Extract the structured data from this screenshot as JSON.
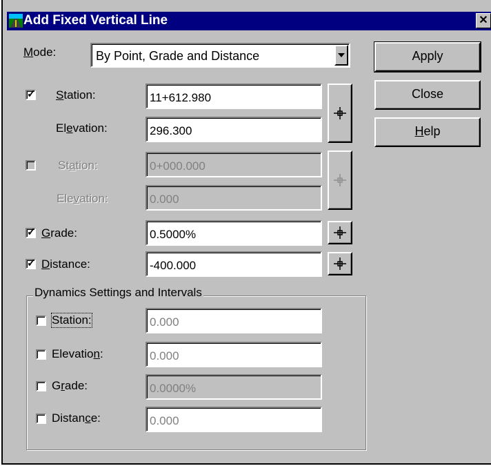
{
  "window": {
    "title": "Add Fixed Vertical Line",
    "close_glyph": "✕"
  },
  "mode": {
    "label_pre": "",
    "label_ul": "M",
    "label_post": "ode:",
    "value": "By Point, Grade and Distance"
  },
  "buttons": {
    "apply": "Apply",
    "close": "Close",
    "help_ul": "H",
    "help_post": "elp"
  },
  "point1": {
    "station": {
      "checked": true,
      "label_pre": "",
      "label_ul": "S",
      "label_post": "tation:",
      "value": "11+612.980"
    },
    "elevation": {
      "label_pre": "El",
      "label_ul": "e",
      "label_post": "vation:",
      "value": "296.300"
    }
  },
  "point2": {
    "station": {
      "checked": false,
      "label_pre": "St",
      "label_ul": "a",
      "label_post": "tion:",
      "value": "0+000.000"
    },
    "elevation": {
      "label_pre": "Ele",
      "label_ul": "v",
      "label_post": "ation:",
      "value": "0.000"
    }
  },
  "grade": {
    "checked": true,
    "label_pre": "",
    "label_ul": "G",
    "label_post": "rade:",
    "value": "0.5000%"
  },
  "distance": {
    "checked": true,
    "label_pre": "",
    "label_ul": "D",
    "label_post": "istance:",
    "value": "-400.000"
  },
  "dynamics": {
    "title": "Dynamics Settings and Intervals",
    "station": {
      "checked": false,
      "label": "Station:",
      "value": "0.000"
    },
    "elevation": {
      "checked": false,
      "label_pre": "Elevatio",
      "label_ul": "n",
      "label_post": ":",
      "value": "0.000"
    },
    "grade": {
      "checked": false,
      "label_pre": "G",
      "label_ul": "r",
      "label_post": "ade:",
      "value": "0.0000%"
    },
    "distance": {
      "checked": false,
      "label_pre": "Distan",
      "label_ul": "c",
      "label_post": "e:",
      "value": "0.000"
    }
  },
  "check_glyph": "✓",
  "colors": {
    "titlebar": "#000080",
    "face": "#c0c0c0",
    "disabled_text": "#808080"
  },
  "icons": {
    "pick": "target-crosshair-icon",
    "app": "road-icon"
  }
}
